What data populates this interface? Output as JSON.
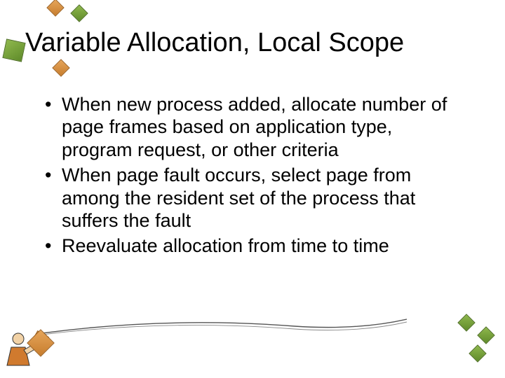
{
  "title": "Variable Allocation, Local Scope",
  "bullets": [
    "When new process added, allocate number of page frames based on application type, program request, or other criteria",
    "When page fault occurs, select page from among the resident set of the process that suffers the fault",
    "Reevaluate allocation from time to time"
  ]
}
